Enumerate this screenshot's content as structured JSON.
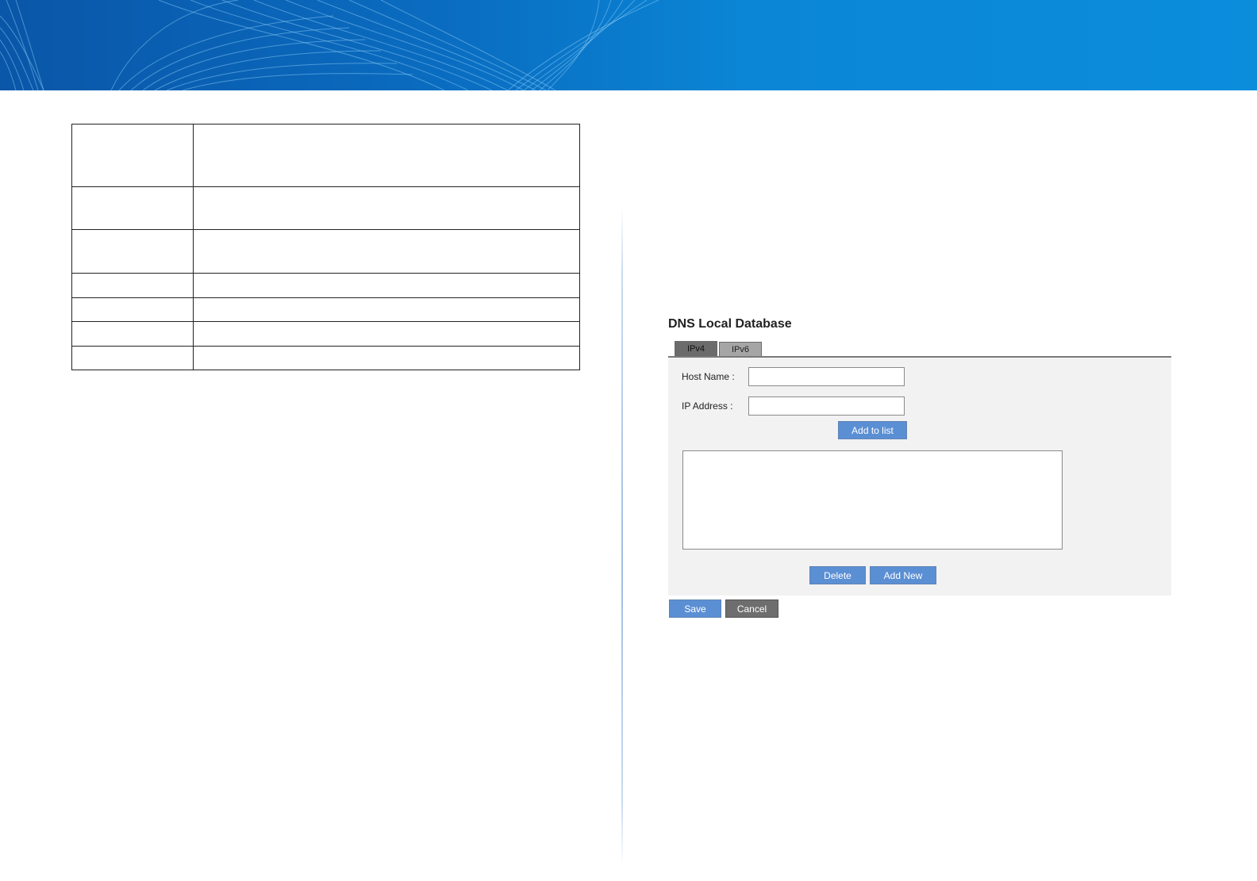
{
  "panel": {
    "title": "DNS Local Database",
    "tabs": [
      {
        "label": "IPv4",
        "active": true
      },
      {
        "label": "IPv6",
        "active": false
      }
    ],
    "fields": {
      "host_name": {
        "label": "Host Name :",
        "value": ""
      },
      "ip_address": {
        "label": "IP Address :",
        "value": ""
      }
    },
    "buttons": {
      "add_to_list": "Add to list",
      "delete": "Delete",
      "add_new": "Add New",
      "save": "Save",
      "cancel": "Cancel"
    },
    "list_entries": []
  },
  "colors": {
    "banner": "#0b86d6",
    "primary_button": "#5b8fd4",
    "secondary_button": "#6e6e6e",
    "form_background": "#f2f2f2"
  }
}
